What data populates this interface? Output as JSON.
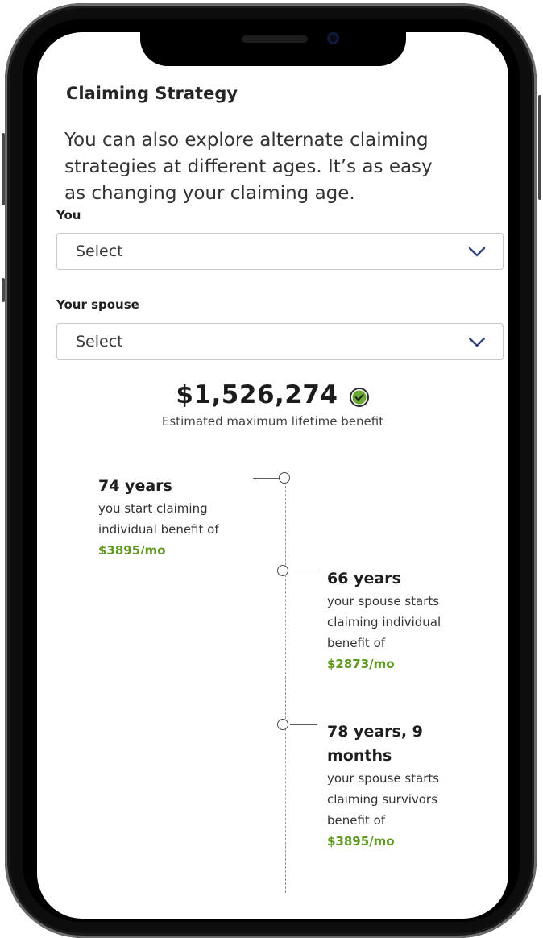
{
  "header": {
    "title": "Claiming Strategy"
  },
  "intro": {
    "text": "You can also explore alternate claiming strategies at different ages. It’s as easy as changing your claiming age."
  },
  "you_select": {
    "label": "You",
    "value": "Select",
    "icon": "chevron-down-icon"
  },
  "spouse_select": {
    "label": "Your spouse",
    "value": "Select",
    "icon": "chevron-down-icon"
  },
  "summary": {
    "amount": "$1,526,274",
    "caption": "Estimated maximum lifetime benefit",
    "icon": "check-circle-icon",
    "icon_color": "#6aa832"
  },
  "timeline": [
    {
      "title": "74 years",
      "lines": [
        "you start claiming",
        "individual benefit of"
      ],
      "amount": "$3895/mo"
    },
    {
      "title": "66 years",
      "lines": [
        "your spouse starts",
        "claiming individual",
        "benefit of"
      ],
      "amount": "$2873/mo"
    },
    {
      "title_lines": [
        "78 years, 9",
        "months"
      ],
      "lines": [
        "your spouse starts",
        "claiming survivors",
        "benefit of"
      ],
      "amount": "$3895/mo"
    }
  ],
  "colors": {
    "accent_green": "#5d9a1d",
    "chevron_blue": "#2d3f7c"
  }
}
